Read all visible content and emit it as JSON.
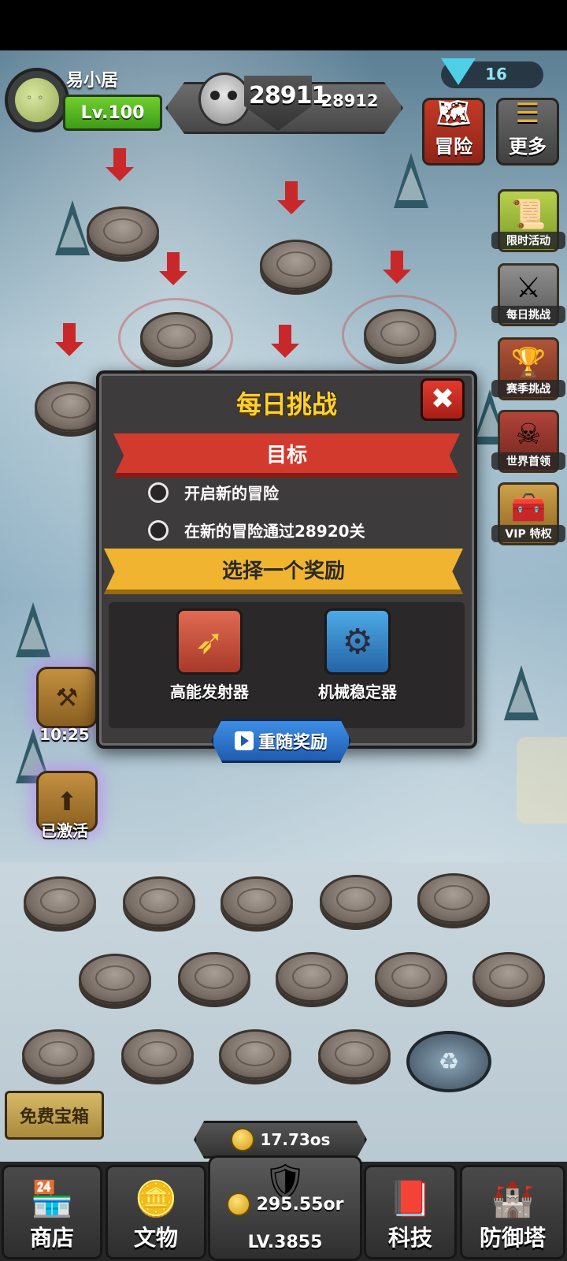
{
  "player": {
    "name": "易小居",
    "level": "Lv.100"
  },
  "power": {
    "current": "28911",
    "next": "28912"
  },
  "gems": {
    "count": "16"
  },
  "top_buttons": {
    "adventure": "冒险",
    "more": "更多"
  },
  "side_menu": [
    {
      "label": "限时活动",
      "icon": "scroll-icon"
    },
    {
      "label": "每日挑战",
      "icon": "crossed-swords-icon"
    },
    {
      "label": "赛季挑战",
      "icon": "trophy-icon"
    },
    {
      "label": "世界首领",
      "icon": "skull-banner-icon"
    },
    {
      "label": "VIP 特权",
      "icon": "treasure-chest-icon"
    }
  ],
  "left_buttons": {
    "anvil_timer": "10:25",
    "boost_status": "已激活"
  },
  "dialog": {
    "title": "每日挑战",
    "goal_header": "目标",
    "objectives": [
      "开启新的冒险",
      "在新的冒险通过28920关"
    ],
    "reward_header": "选择一个奖励",
    "rewards": [
      {
        "label": "高能发射器",
        "icon": "energy-launcher-icon"
      },
      {
        "label": "机械稳定器",
        "icon": "mechanical-stabilizer-icon"
      }
    ],
    "reroll_label": "重随奖励"
  },
  "bottom": {
    "free_chest": "免费宝箱",
    "gold_rate": "17.73os",
    "center_gold": "295.55or",
    "center_level": "LV.3855",
    "tabs": {
      "shop": "商店",
      "artifacts": "文物",
      "tech": "科技",
      "towers": "防御塔"
    }
  },
  "colors": {
    "title_yellow": "#ffd12e",
    "goal_red": "#d23a2e",
    "reward_gold": "#f0b431",
    "reroll_blue": "#3e8fe6"
  }
}
